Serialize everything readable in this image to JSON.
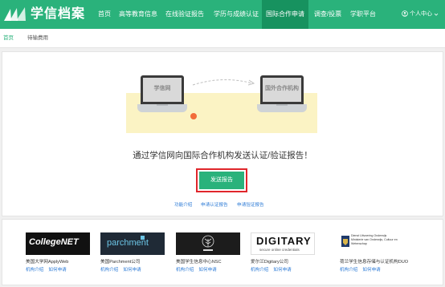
{
  "header": {
    "logo_text": "学信档案",
    "nav": [
      {
        "label": "首页",
        "active": false
      },
      {
        "label": "高等教育信息",
        "active": false
      },
      {
        "label": "在线验证报告",
        "active": false
      },
      {
        "label": "学历与成绩认证",
        "active": false
      },
      {
        "label": "国际合作申请",
        "active": true
      },
      {
        "label": "调查/投票",
        "active": false
      },
      {
        "label": "学职平台",
        "active": false
      }
    ],
    "user_label": "个人中心",
    "colors": {
      "brand": "#2ab27b",
      "active_nav": "#17925f"
    }
  },
  "subnav": [
    {
      "label": "首页",
      "active": true
    },
    {
      "label": "待输费用",
      "active": false
    }
  ],
  "hero": {
    "left_screen": "学信网",
    "right_screen": "国外合作机构",
    "headline": "通过学信网向国际合作机构发送认证/验证报告！",
    "button_label": "发送报告",
    "links": [
      "功能介绍",
      "申请认证报告",
      "申请验证报告"
    ]
  },
  "partners": [
    {
      "logo_text": "CollegeNET",
      "name": "美国大学网ApplyWeb",
      "links": [
        "机构介绍",
        "如何申请"
      ]
    },
    {
      "logo_text": "parchment",
      "name": "美国Parchment公司",
      "links": [
        "机构介绍",
        "如何申请"
      ]
    },
    {
      "logo_text": "NSC",
      "name": "美国学生信息中心NSC",
      "links": [
        "机构介绍",
        "如何申请"
      ]
    },
    {
      "logo_text": "DIGITARY",
      "logo_sub": "secure online credentials",
      "name": "爱尔兰Digitary公司",
      "links": [
        "机构介绍",
        "如何申请"
      ]
    },
    {
      "logo_text": "Dienst Uitvoering Onderwijs\nMinisterie van Onderwijs, Cultuur en Wetenschap",
      "name": "荷兰学生信息存储与认证机构DUO",
      "links": [
        "机构介绍",
        "如何申请"
      ]
    }
  ]
}
